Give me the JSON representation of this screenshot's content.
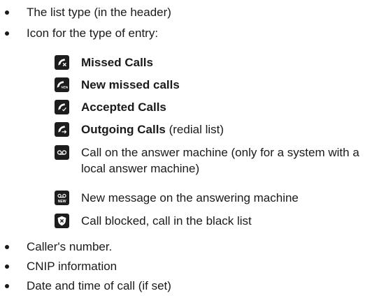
{
  "bullets_top": [
    "The list type (in the header)",
    "Icon for the type of entry:"
  ],
  "entries": [
    {
      "icon": "missed-call-icon",
      "label": "Missed Calls",
      "suffix": ""
    },
    {
      "icon": "new-missed-call-icon",
      "label": "New missed calls",
      "suffix": ""
    },
    {
      "icon": "accepted-call-icon",
      "label": "Accepted Calls",
      "suffix": ""
    },
    {
      "icon": "outgoing-call-icon",
      "label": "Outgoing Calls",
      "suffix": " (redial list)"
    },
    {
      "icon": "answer-machine-icon",
      "line1": "Call on the answer machine (only for a system with a",
      "line2": "local answer machine)"
    },
    {
      "icon": "new-message-icon",
      "text": "New message on the answering machine"
    },
    {
      "icon": "blocked-call-icon",
      "text": "Call blocked, call in the black list"
    }
  ],
  "bullets_bottom": [
    "Caller's number.",
    "CNIP information",
    "Date and time of call (if set)"
  ]
}
